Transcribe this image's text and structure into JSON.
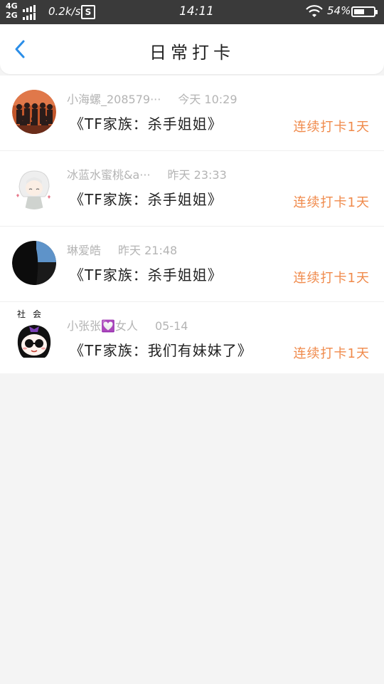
{
  "status_bar": {
    "network_top": "4G",
    "network_bottom": "2G",
    "speed": "0.2k/s",
    "sim_icon_text": "S",
    "time": "14:11",
    "battery_text": "54%",
    "battery_level": 0.54
  },
  "header": {
    "title": "日常打卡",
    "back_icon": "chevron-left-icon",
    "accent": "#2b8ee8"
  },
  "entries": [
    {
      "user": "小海螺_208579···",
      "time": "今天 10:29",
      "content": "《TF家族：杀手姐姐》",
      "streak": "连续打卡1天"
    },
    {
      "user": "冰蓝水蜜桃&a···",
      "time": "昨天 23:33",
      "content": "《TF家族：杀手姐姐》",
      "streak": "连续打卡1天"
    },
    {
      "user": "琳爱皓",
      "time": "昨天 21:48",
      "content": "《TF家族：杀手姐姐》",
      "streak": "连续打卡1天"
    },
    {
      "user": "小张张💟女人",
      "time": "05-14",
      "content": "《TF家族：我们有妹妹了》",
      "streak": "连续打卡1天"
    }
  ],
  "avatar4_caption": "社会",
  "colors": {
    "streak": "#f08a4b",
    "meta": "#b4b4b4",
    "background": "#f4f4f4"
  }
}
